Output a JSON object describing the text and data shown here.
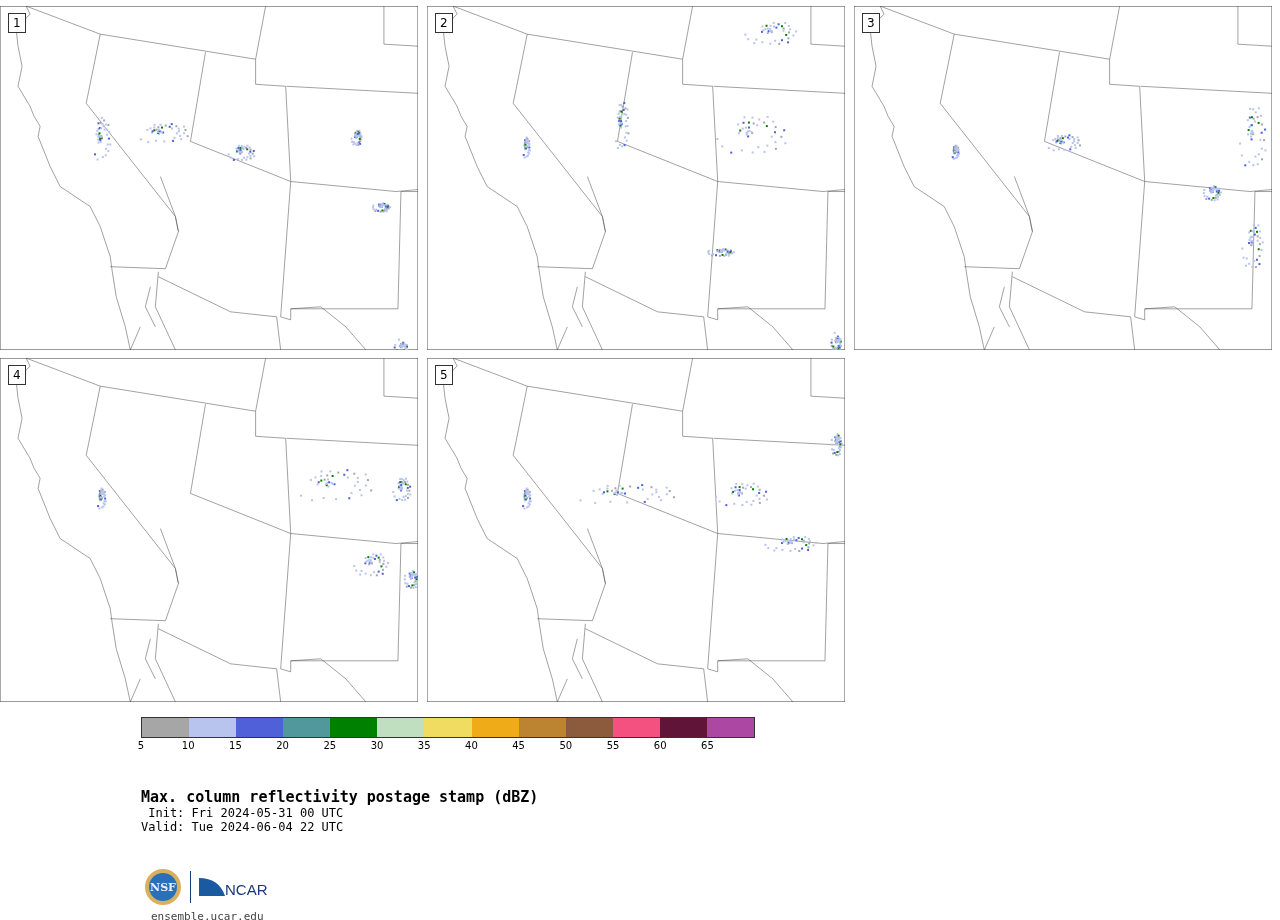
{
  "panels": [
    {
      "number": "1"
    },
    {
      "number": "2"
    },
    {
      "number": "3"
    },
    {
      "number": "4"
    },
    {
      "number": "5"
    }
  ],
  "colorbar": {
    "bins": [
      {
        "color": "#a6a6a6"
      },
      {
        "color": "#b8c4ee"
      },
      {
        "color": "#5060d8"
      },
      {
        "color": "#50989c"
      },
      {
        "color": "#008000"
      },
      {
        "color": "#c0dec0"
      },
      {
        "color": "#f0dc60"
      },
      {
        "color": "#f0ac18"
      },
      {
        "color": "#bc8430"
      },
      {
        "color": "#8c5a3c"
      },
      {
        "color": "#f45080"
      },
      {
        "color": "#601438"
      },
      {
        "color": "#ac48a4"
      }
    ],
    "ticks": [
      "5",
      "10",
      "15",
      "20",
      "25",
      "30",
      "35",
      "40",
      "45",
      "50",
      "55",
      "60",
      "65"
    ]
  },
  "title": "Max. column reflectivity postage stamp (dBZ)",
  "init": " Init: Fri 2024-05-31 00 UTC",
  "valid": "Valid: Tue 2024-06-04 22 UTC",
  "logos": {
    "nsf": "NSF",
    "ncar": "NCAR"
  },
  "url": "ensemble.ucar.edu"
}
